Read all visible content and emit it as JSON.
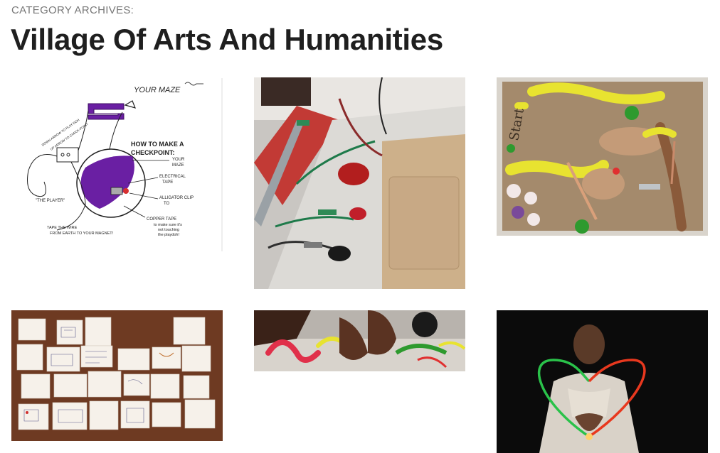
{
  "header": {
    "archive_label": "CATEGORY ARCHIVES:",
    "title": "Village Of Arts And Humanities"
  },
  "sketch": {
    "your_maze": "YOUR MAZE",
    "how_to": "HOW TO MAKE A",
    "checkpoint": "CHECKPOINT:",
    "label_your_maze": "YOUR",
    "label_maze": "MAZE",
    "label_electrical": "ELECTRICAL",
    "label_tape": "TAPE",
    "label_alligator": "ALLIGATOR CLIP",
    "label_to": "TO",
    "label_copper": "COPPER TAPE",
    "label_copper_note1": "to make sure it's",
    "label_copper_note2": "not touching",
    "label_copper_note3": "the playdoh!",
    "label_player": "\"THE PLAYER\"",
    "label_tape_wire1": "TAPE THE WIRE",
    "label_tape_wire2": "FROM EARTH TO YOUR MAGNET!",
    "label_arrow1": "DOWN ARROW TO PLAY-DOH",
    "label_arrow2": "UP ARROW TO CHECK-POINT"
  },
  "maze_photo": {
    "start_text": "Start"
  },
  "colors": {
    "title": "#1f1f1f",
    "archive_label": "#777777",
    "purple": "#6a1fa3",
    "playdoh_yellow": "#e8e330",
    "cardboard": "#a48a6c"
  }
}
